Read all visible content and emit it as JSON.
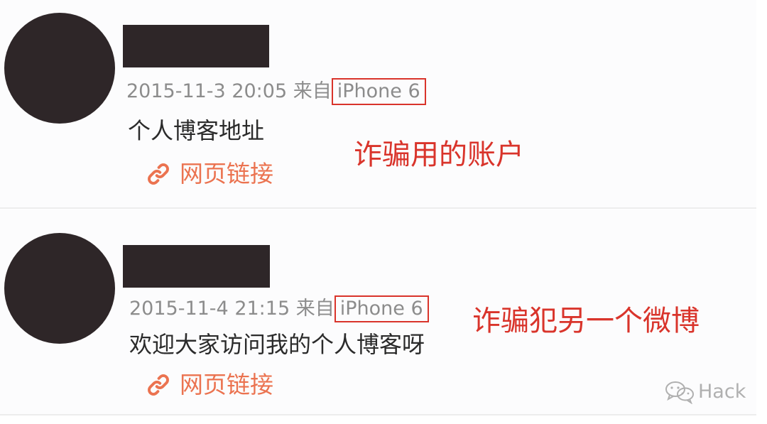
{
  "posts": [
    {
      "meta": {
        "date": "2015-11-3 20:05",
        "source_prefix": "来自",
        "device": "iPhone 6"
      },
      "text": "个人博客地址",
      "link_label": "网页链接",
      "annotation": "诈骗用的账户"
    },
    {
      "meta": {
        "date": "2015-11-4 21:15",
        "source_prefix": "来自",
        "device": "iPhone 6"
      },
      "text": "欢迎大家访问我的个人博客呀",
      "link_label": "网页链接",
      "annotation": "诈骗犯另一个微博"
    }
  ],
  "watermark": {
    "label": "Hack"
  },
  "colors": {
    "redaction": "#2e2628",
    "link": "#eb7350",
    "annotation": "#d9342b",
    "meta": "#8c8c8c"
  },
  "icons": {
    "link": "link-chain-icon",
    "watermark": "wechat-icon"
  }
}
